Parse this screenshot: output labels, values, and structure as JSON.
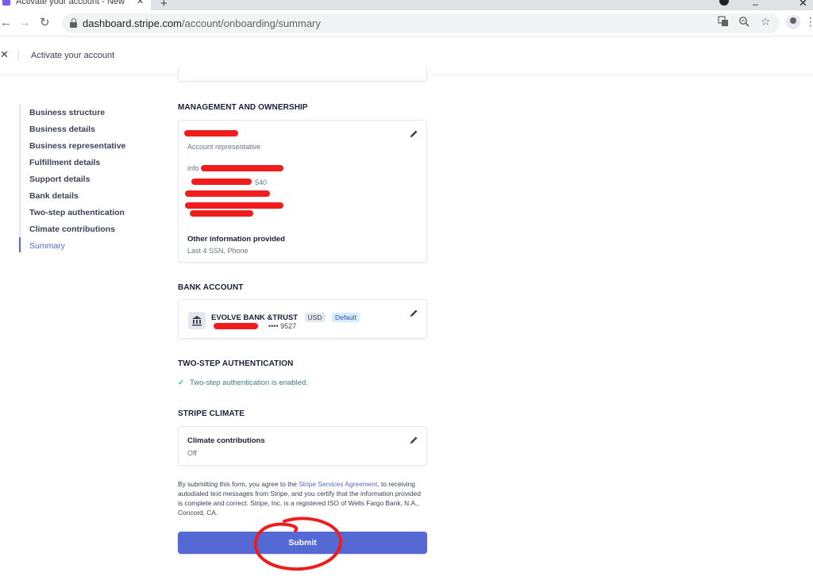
{
  "browser": {
    "tab_title": "Activate your account - New bu",
    "url_host": "dashboard.stripe.com",
    "url_path": "/account/onboarding/summary"
  },
  "header": {
    "title": "Activate your account"
  },
  "sidebar": {
    "items": [
      {
        "label": "Business structure"
      },
      {
        "label": "Business details"
      },
      {
        "label": "Business representative"
      },
      {
        "label": "Fulfillment details"
      },
      {
        "label": "Support details"
      },
      {
        "label": "Bank details"
      },
      {
        "label": "Two-step authentication"
      },
      {
        "label": "Climate contributions"
      },
      {
        "label": "Summary"
      }
    ],
    "active": "Summary"
  },
  "management": {
    "heading": "MANAGEMENT AND OWNERSHIP",
    "role": "Account representative",
    "partial_email": "info",
    "partial_ssn_digits": "540",
    "other_info_label": "Other information provided",
    "other_info_value": "Last 4 SSN, Phone"
  },
  "bank": {
    "heading": "BANK ACCOUNT",
    "name": "EVOLVE BANK &TRUST",
    "currency": "USD",
    "default_badge": "Default",
    "masked_number": "•••• 9527"
  },
  "two_step": {
    "heading": "TWO-STEP AUTHENTICATION",
    "status": "Two-step authentication is enabled."
  },
  "climate": {
    "heading": "STRIPE CLIMATE",
    "label": "Climate contributions",
    "value": "Off"
  },
  "legal": {
    "before_link": "By submitting this form, you agree to the ",
    "link": "Stripe Services Agreement",
    "after_link": ", to receiving autodialed text messages from Stripe, and you certify that the information provided is complete and correct. Stripe, Inc. is a registered ISO of Wells Fargo Bank, N.A., Concord, CA."
  },
  "submit_label": "Submit",
  "colors": {
    "accent": "#5469d4",
    "redaction": "#f01d1d",
    "success": "#0e9f6e"
  }
}
